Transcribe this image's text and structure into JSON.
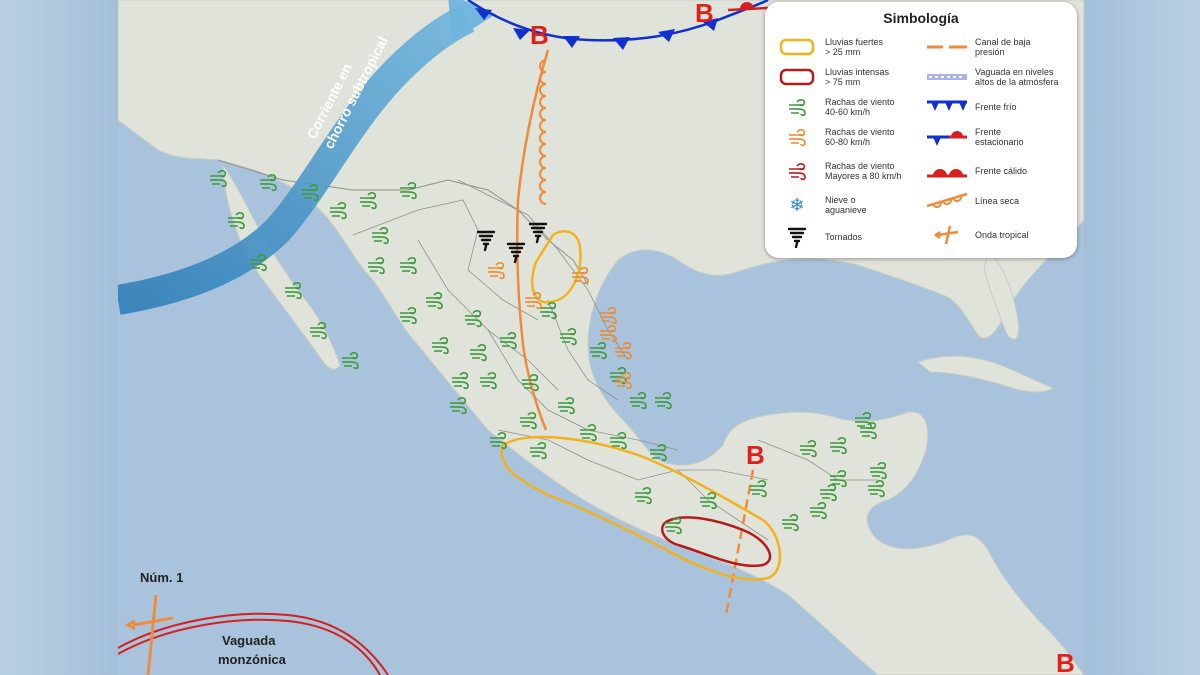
{
  "legend": {
    "title": "Simbología",
    "items": [
      {
        "label": "Lluvias fuertes\n> 25 mm",
        "icon": "yellow-rain-rect-icon"
      },
      {
        "label": "Lluvias intensas\n> 75 mm",
        "icon": "red-rain-rect-icon"
      },
      {
        "label": "Rachas de viento\n40-60 km/h",
        "icon": "green-wind-icon"
      },
      {
        "label": "Rachas de viento\n60-80 km/h",
        "icon": "orange-wind-icon"
      },
      {
        "label": "Rachas de viento\nMayores a 80 km/h",
        "icon": "red-wind-icon"
      },
      {
        "label": "Nieve o\naguanieve",
        "icon": "snowflake-icon"
      },
      {
        "label": "Tornados",
        "icon": "tornado-icon"
      },
      {
        "label": "Canal de baja\npresión",
        "icon": "low-pressure-channel-icon"
      },
      {
        "label": "Vaguada en niveles\naltos de la atmósfera",
        "icon": "upper-trough-icon"
      },
      {
        "label": "Frente frío",
        "icon": "cold-front-icon"
      },
      {
        "label": "Frente\nestacionario",
        "icon": "stationary-front-icon"
      },
      {
        "label": "Frente cálido",
        "icon": "warm-front-icon"
      },
      {
        "label": "Línea seca",
        "icon": "dry-line-icon"
      },
      {
        "label": "Onda tropical",
        "icon": "tropical-wave-icon"
      }
    ]
  },
  "map": {
    "jet_label": "Corriente en\nchorro subtropical",
    "jet_line1": "Corriente en",
    "jet_line2": "chorro subtropical",
    "low_letter": "B",
    "wave_label": "Núm. 1",
    "monsoon_line1": "Vaguada",
    "monsoon_line2": "monzónica"
  },
  "colors": {
    "ocean": "#a9c3dc",
    "land": "#dfe3da",
    "jet": "#3a8fc6",
    "cold_front": "#1030d0",
    "warm_front": "#d42020",
    "low_letter": "#e0201c",
    "trough": "#f08a3c",
    "rain_yellow": "#f2b21c",
    "rain_red": "#b81a1a",
    "wind_green": "#3c9a3c",
    "wind_orange": "#ee8a2a"
  }
}
